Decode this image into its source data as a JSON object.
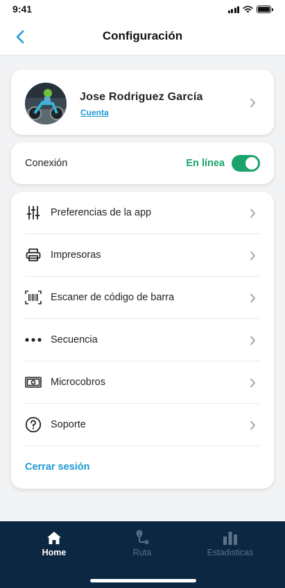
{
  "status_bar": {
    "time": "9:41"
  },
  "header": {
    "title": "Configuración"
  },
  "profile": {
    "name": "Jose Rodriguez García",
    "account_link": "Cuenta"
  },
  "connection": {
    "label": "Conexión",
    "status": "En línea",
    "toggle_on": true
  },
  "menu": {
    "items": [
      {
        "label": "Preferencias de la app",
        "icon": "sliders-icon"
      },
      {
        "label": "Impresoras",
        "icon": "printer-icon"
      },
      {
        "label": "Escaner de código de barra",
        "icon": "barcode-icon"
      },
      {
        "label": "Secuencia",
        "icon": "dots-icon"
      },
      {
        "label": "Microcobros",
        "icon": "cash-icon"
      },
      {
        "label": "Soporte",
        "icon": "help-icon"
      }
    ],
    "logout": "Cerrar sesión"
  },
  "bottom_nav": {
    "tabs": [
      {
        "label": "Home",
        "icon": "home-icon",
        "active": true
      },
      {
        "label": "Ruta",
        "icon": "route-icon",
        "active": false
      },
      {
        "label": "Estadisticas",
        "icon": "bar-chart-icon",
        "active": false
      }
    ]
  },
  "colors": {
    "accent_blue": "#1b9ad6",
    "online_green": "#1aa36a",
    "nav_background": "#0b2742",
    "nav_inactive": "#5d7287"
  }
}
